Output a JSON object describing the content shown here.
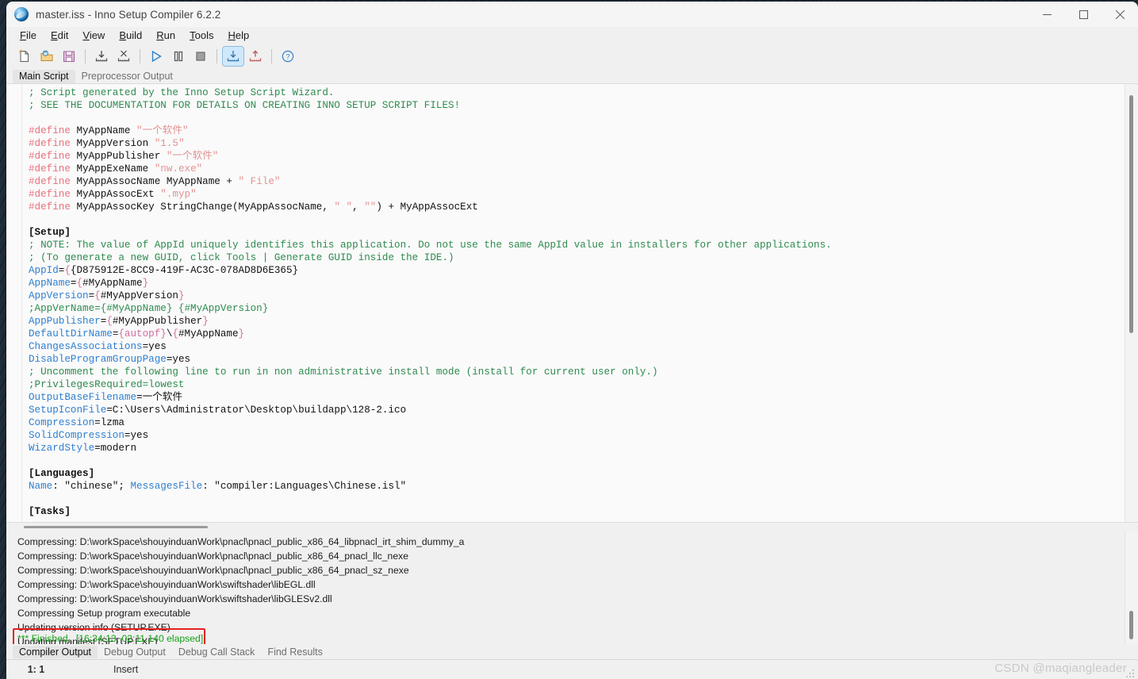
{
  "window": {
    "title": "master.iss - Inno Setup Compiler 6.2.2",
    "icon": "inno-setup-globe-icon",
    "controls": {
      "minimize": "—",
      "maximize": "□",
      "close": "✕"
    }
  },
  "menubar": {
    "items": [
      {
        "label": "File",
        "mnemonic": "F"
      },
      {
        "label": "Edit",
        "mnemonic": "E"
      },
      {
        "label": "View",
        "mnemonic": "V"
      },
      {
        "label": "Build",
        "mnemonic": "B"
      },
      {
        "label": "Run",
        "mnemonic": "R"
      },
      {
        "label": "Tools",
        "mnemonic": "T"
      },
      {
        "label": "Help",
        "mnemonic": "H"
      }
    ]
  },
  "toolbar": {
    "buttons": [
      {
        "name": "new-file-icon",
        "title": "New"
      },
      {
        "name": "open-file-icon",
        "title": "Open"
      },
      {
        "name": "save-file-icon",
        "title": "Save"
      },
      {
        "name": "separator",
        "title": ""
      },
      {
        "name": "import-icon",
        "title": "Import"
      },
      {
        "name": "clear-icon",
        "title": "Clear"
      },
      {
        "name": "separator",
        "title": ""
      },
      {
        "name": "run-icon",
        "title": "Run"
      },
      {
        "name": "pause-icon",
        "title": "Pause"
      },
      {
        "name": "stop-icon",
        "title": "Stop"
      },
      {
        "name": "separator",
        "title": ""
      },
      {
        "name": "compile-icon",
        "title": "Compile"
      },
      {
        "name": "upload-icon",
        "title": "Publish"
      },
      {
        "name": "separator",
        "title": ""
      },
      {
        "name": "help-icon",
        "title": "Help"
      }
    ]
  },
  "editor_tabs": {
    "items": [
      {
        "label": "Main Script",
        "selected": true
      },
      {
        "label": "Preprocessor Output",
        "selected": false
      }
    ]
  },
  "editor": {
    "lines": [
      [
        {
          "t": "; Script generated by the Inno Setup Script Wizard.",
          "c": "cm"
        }
      ],
      [
        {
          "t": "; SEE THE DOCUMENTATION FOR DETAILS ON CREATING INNO SETUP SCRIPT FILES!",
          "c": "cm"
        }
      ],
      [],
      [
        {
          "t": "#define",
          "c": "dfn"
        },
        {
          "t": " MyAppName ",
          "c": "pln"
        },
        {
          "t": "\"一个软件\"",
          "c": "str"
        }
      ],
      [
        {
          "t": "#define",
          "c": "dfn"
        },
        {
          "t": " MyAppVersion ",
          "c": "pln"
        },
        {
          "t": "\"1.5\"",
          "c": "str"
        }
      ],
      [
        {
          "t": "#define",
          "c": "dfn"
        },
        {
          "t": " MyAppPublisher ",
          "c": "pln"
        },
        {
          "t": "\"一个软件\"",
          "c": "str"
        }
      ],
      [
        {
          "t": "#define",
          "c": "dfn"
        },
        {
          "t": " MyAppExeName ",
          "c": "pln"
        },
        {
          "t": "\"nw.exe\"",
          "c": "str"
        }
      ],
      [
        {
          "t": "#define",
          "c": "dfn"
        },
        {
          "t": " MyAppAssocName MyAppName + ",
          "c": "pln"
        },
        {
          "t": "\" File\"",
          "c": "str"
        }
      ],
      [
        {
          "t": "#define",
          "c": "dfn"
        },
        {
          "t": " MyAppAssocExt ",
          "c": "pln"
        },
        {
          "t": "\".myp\"",
          "c": "str"
        }
      ],
      [
        {
          "t": "#define",
          "c": "dfn"
        },
        {
          "t": " MyAppAssocKey StringChange(MyAppAssocName, ",
          "c": "pln"
        },
        {
          "t": "\" \"",
          "c": "str"
        },
        {
          "t": ", ",
          "c": "pln"
        },
        {
          "t": "\"\"",
          "c": "str"
        },
        {
          "t": ") + MyAppAssocExt",
          "c": "pln"
        }
      ],
      [],
      [
        {
          "t": "[Setup]",
          "c": "sec"
        }
      ],
      [
        {
          "t": "; NOTE: The value of AppId uniquely identifies this application. Do not use the same AppId value in installers for other applications.",
          "c": "cm"
        }
      ],
      [
        {
          "t": "; (To generate a new GUID, click Tools | Generate GUID inside the IDE.)",
          "c": "cm"
        }
      ],
      [
        {
          "t": "AppId",
          "c": "key"
        },
        {
          "t": "=",
          "c": "pln"
        },
        {
          "t": "{",
          "c": "brc"
        },
        {
          "t": "{D875912E-8CC9-419F-AC3C-078AD8D6E365}",
          "c": "pln"
        }
      ],
      [
        {
          "t": "AppName",
          "c": "key"
        },
        {
          "t": "=",
          "c": "pln"
        },
        {
          "t": "{",
          "c": "brc"
        },
        {
          "t": "#MyAppName",
          "c": "pln"
        },
        {
          "t": "}",
          "c": "brc"
        }
      ],
      [
        {
          "t": "AppVersion",
          "c": "key"
        },
        {
          "t": "=",
          "c": "pln"
        },
        {
          "t": "{",
          "c": "brc"
        },
        {
          "t": "#MyAppVersion",
          "c": "pln"
        },
        {
          "t": "}",
          "c": "brc"
        }
      ],
      [
        {
          "t": ";AppVerName={#MyAppName} {#MyAppVersion}",
          "c": "cm"
        }
      ],
      [
        {
          "t": "AppPublisher",
          "c": "key"
        },
        {
          "t": "=",
          "c": "pln"
        },
        {
          "t": "{",
          "c": "brc"
        },
        {
          "t": "#MyAppPublisher",
          "c": "pln"
        },
        {
          "t": "}",
          "c": "brc"
        }
      ],
      [
        {
          "t": "DefaultDirName",
          "c": "key"
        },
        {
          "t": "=",
          "c": "pln"
        },
        {
          "t": "{autopf}",
          "c": "brc"
        },
        {
          "t": "\\",
          "c": "pln"
        },
        {
          "t": "{",
          "c": "brc"
        },
        {
          "t": "#MyAppName",
          "c": "pln"
        },
        {
          "t": "}",
          "c": "brc"
        }
      ],
      [
        {
          "t": "ChangesAssociations",
          "c": "key"
        },
        {
          "t": "=yes",
          "c": "pln"
        }
      ],
      [
        {
          "t": "DisableProgramGroupPage",
          "c": "key"
        },
        {
          "t": "=yes",
          "c": "pln"
        }
      ],
      [
        {
          "t": "; Uncomment the following line to run in non administrative install mode (install for current user only.)",
          "c": "cm"
        }
      ],
      [
        {
          "t": ";PrivilegesRequired=lowest",
          "c": "cm"
        }
      ],
      [
        {
          "t": "OutputBaseFilename",
          "c": "key"
        },
        {
          "t": "=一个软件",
          "c": "pln"
        }
      ],
      [
        {
          "t": "SetupIconFile",
          "c": "key"
        },
        {
          "t": "=C:\\Users\\Administrator\\Desktop\\buildapp\\128-2.ico",
          "c": "pln"
        }
      ],
      [
        {
          "t": "Compression",
          "c": "key"
        },
        {
          "t": "=lzma",
          "c": "pln"
        }
      ],
      [
        {
          "t": "SolidCompression",
          "c": "key"
        },
        {
          "t": "=yes",
          "c": "pln"
        }
      ],
      [
        {
          "t": "WizardStyle",
          "c": "key"
        },
        {
          "t": "=modern",
          "c": "pln"
        }
      ],
      [],
      [
        {
          "t": "[Languages]",
          "c": "sec"
        }
      ],
      [
        {
          "t": "Name",
          "c": "key"
        },
        {
          "t": ": \"chinese\"; ",
          "c": "pln"
        },
        {
          "t": "MessagesFile",
          "c": "key"
        },
        {
          "t": ": \"compiler:Languages\\Chinese.isl\"",
          "c": "pln"
        }
      ],
      [],
      [
        {
          "t": "[Tasks]",
          "c": "sec"
        }
      ]
    ]
  },
  "output": {
    "lines": [
      "Compressing: D:\\workSpace\\shouyinduanWork\\pnacl\\pnacl_public_x86_64_libpnacl_irt_shim_dummy_a",
      "Compressing: D:\\workSpace\\shouyinduanWork\\pnacl\\pnacl_public_x86_64_pnacl_llc_nexe",
      "Compressing: D:\\workSpace\\shouyinduanWork\\pnacl\\pnacl_public_x86_64_pnacl_sz_nexe",
      "Compressing: D:\\workSpace\\shouyinduanWork\\swiftshader\\libEGL.dll",
      "Compressing: D:\\workSpace\\shouyinduanWork\\swiftshader\\libGLESv2.dll",
      "Compressing Setup program executable",
      "Updating version info (SETUP.EXE)",
      "Updating manifest (SETUP.EXE)"
    ],
    "finished_line": "*** Finished.  [16:34:13, 02:11.140 elapsed]",
    "finished_color": "#16a316",
    "highlight_color": "#e62020"
  },
  "bottom_tabs": {
    "items": [
      {
        "label": "Compiler Output",
        "selected": true
      },
      {
        "label": "Debug Output",
        "selected": false
      },
      {
        "label": "Debug Call Stack",
        "selected": false
      },
      {
        "label": "Find Results",
        "selected": false
      }
    ]
  },
  "statusbar": {
    "cursor_position": "1:  1",
    "insert_mode": "Insert",
    "watermark": "CSDN @maqiangleader"
  }
}
